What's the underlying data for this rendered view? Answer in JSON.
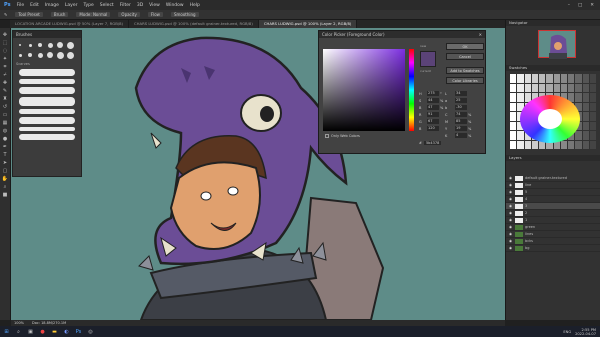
{
  "menubar": {
    "logo": "Ps",
    "items": [
      "File",
      "Edit",
      "Image",
      "Layer",
      "Type",
      "Select",
      "Filter",
      "3D",
      "View",
      "Window",
      "Help"
    ]
  },
  "options": {
    "chips": [
      "Tool Preset",
      "Brush",
      "Mode: Normal",
      "Opacity",
      "Flow",
      "Smoothing"
    ]
  },
  "tabs": [
    {
      "label": "LOCATION ARCADE LUDWIG.psd @ 50% (Layer 7, RGB/8)",
      "active": false
    },
    {
      "label": "CHARS LUDWIG.psd @ 100% (default grainer-textured, RGB/8)",
      "active": false
    },
    {
      "label": "CHARS LUDWIG.psd @ 100% (Layer 2, RGB/8)",
      "active": true
    }
  ],
  "brushes_panel": {
    "title": "Brushes",
    "group_label": "Scarves"
  },
  "color_picker": {
    "title": "Color Picker (Foreground Color)",
    "new_label": "new",
    "current_label": "current",
    "buttons": [
      "OK",
      "Cancel",
      "Add to Swatches",
      "Color Libraries"
    ],
    "fields": [
      {
        "k": "H",
        "v": "275",
        "u": "°",
        "k2": "L",
        "v2": "34",
        "u2": ""
      },
      {
        "k": "S",
        "v": "44",
        "u": "%",
        "k2": "a",
        "v2": "25",
        "u2": ""
      },
      {
        "k": "B",
        "v": "47",
        "u": "%",
        "k2": "b",
        "v2": "-30",
        "u2": ""
      },
      {
        "k": "R",
        "v": "91",
        "u": "",
        "k2": "C",
        "v2": "74",
        "u2": "%"
      },
      {
        "k": "G",
        "v": "67",
        "u": "",
        "k2": "M",
        "v2": "85",
        "u2": "%"
      },
      {
        "k": "B",
        "v": "120",
        "u": "",
        "k2": "Y",
        "v2": "19",
        "u2": "%"
      },
      {
        "k": "",
        "v": "",
        "u": "",
        "k2": "K",
        "v2": "4",
        "u2": "%"
      }
    ],
    "web_colors_label": "Only Web Colors",
    "hex": "5b4378",
    "current_color": "#5b4378"
  },
  "panels": {
    "navigator": "Navigator",
    "swatches": "Swatches",
    "layers": "Layers"
  },
  "layers": [
    {
      "name": "default grainer-textured",
      "group": false,
      "sel": false
    },
    {
      "name": "line",
      "group": false,
      "sel": false
    },
    {
      "name": "5",
      "group": false,
      "sel": false
    },
    {
      "name": "4",
      "group": false,
      "sel": false
    },
    {
      "name": "3",
      "group": false,
      "sel": true
    },
    {
      "name": "2",
      "group": false,
      "sel": false
    },
    {
      "name": "1",
      "group": false,
      "sel": false
    },
    {
      "name": "green",
      "group": true,
      "sel": false
    },
    {
      "name": "lines",
      "group": true,
      "sel": false
    },
    {
      "name": "bcks",
      "group": true,
      "sel": false
    },
    {
      "name": "bg",
      "group": true,
      "sel": false
    }
  ],
  "status": {
    "zoom": "100%",
    "doc": "Doc: 18.8M/270.1M"
  },
  "taskbar": {
    "time": "2:55 PM",
    "date": "2022-04-07",
    "lang": "ENG"
  },
  "colors": {
    "canvas": "#5e8c88",
    "hood": "#6b4d96",
    "accent": "#5b4378"
  }
}
